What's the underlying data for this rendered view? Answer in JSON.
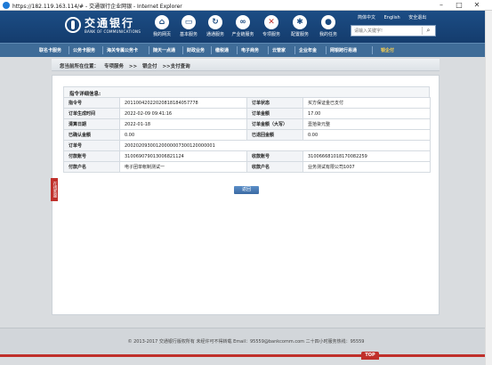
{
  "window": {
    "title": "https://182.119.163.114/# - 交通银行企业网银 - Internet Explorer",
    "minimize": "–",
    "maximize": "□",
    "close": "✕"
  },
  "header": {
    "logo_cn": "交通银行",
    "logo_en": "BANK OF COMMUNICATIONS",
    "nav": [
      {
        "label": "我的网页",
        "icon": "home-icon",
        "glyph": "⌂"
      },
      {
        "label": "基本服务",
        "icon": "monitor-icon",
        "glyph": "▭"
      },
      {
        "label": "通通服务",
        "icon": "cycle-icon",
        "glyph": "↻"
      },
      {
        "label": "产业链服务",
        "icon": "link-icon",
        "glyph": "∞"
      },
      {
        "label": "专项服务",
        "icon": "tools-icon",
        "glyph": "✕"
      },
      {
        "label": "配置服务",
        "icon": "gear-icon",
        "glyph": "✱"
      },
      {
        "label": "我的任务",
        "icon": "user-icon",
        "glyph": "●"
      }
    ],
    "top_links": [
      "简体中文",
      "English",
      "安全退出"
    ],
    "search": {
      "placeholder": "请输入关键字!",
      "icon": "search-icon"
    }
  },
  "menu": {
    "items": [
      "联名卡服务",
      "公务卡服务",
      "海关专属公务卡",
      "随天一点通",
      "财政业务",
      "缴税通",
      "电子商务",
      "云管家",
      "企业年金",
      "网银跨行易通",
      "银企付"
    ],
    "active": "银企付"
  },
  "breadcrumb": {
    "prefix": "您当前所在位置：",
    "items": [
      "专项服务",
      ">>",
      "银企付",
      ">>支付查询"
    ]
  },
  "panel": {
    "title": "指令详细信息:",
    "rows": [
      [
        "指令号",
        "20110042022020818184057778",
        "订单状态",
        "买方保证金已支付"
      ],
      [
        "订单生成时间",
        "2022-02-09 09:41:16",
        "订单金额",
        "17.00"
      ],
      [
        "清算日期",
        "2022-01-18",
        "订单金额（大写）",
        "壹拾柒元整"
      ],
      [
        "已确认金额",
        "0.00",
        "已退回金额",
        "0.00"
      ],
      [
        "订单号",
        "20020209300120000007300120000001",
        "",
        ""
      ],
      [
        "付款账号",
        "310069079013006821124",
        "收款账号",
        "310066681018170082259"
      ],
      [
        "付款户名",
        "电子团单帐制测试一",
        "收款户名",
        "业务测试有限公司1007"
      ]
    ],
    "back_label": "返回"
  },
  "side_tab": "在线客服",
  "footer": {
    "text": "© 2013-2017 交通银行版权所有 未经许可不得转载 Email：95559@bankcomm.com 二十四小时服务热线：95559",
    "top_label": "TOP"
  }
}
